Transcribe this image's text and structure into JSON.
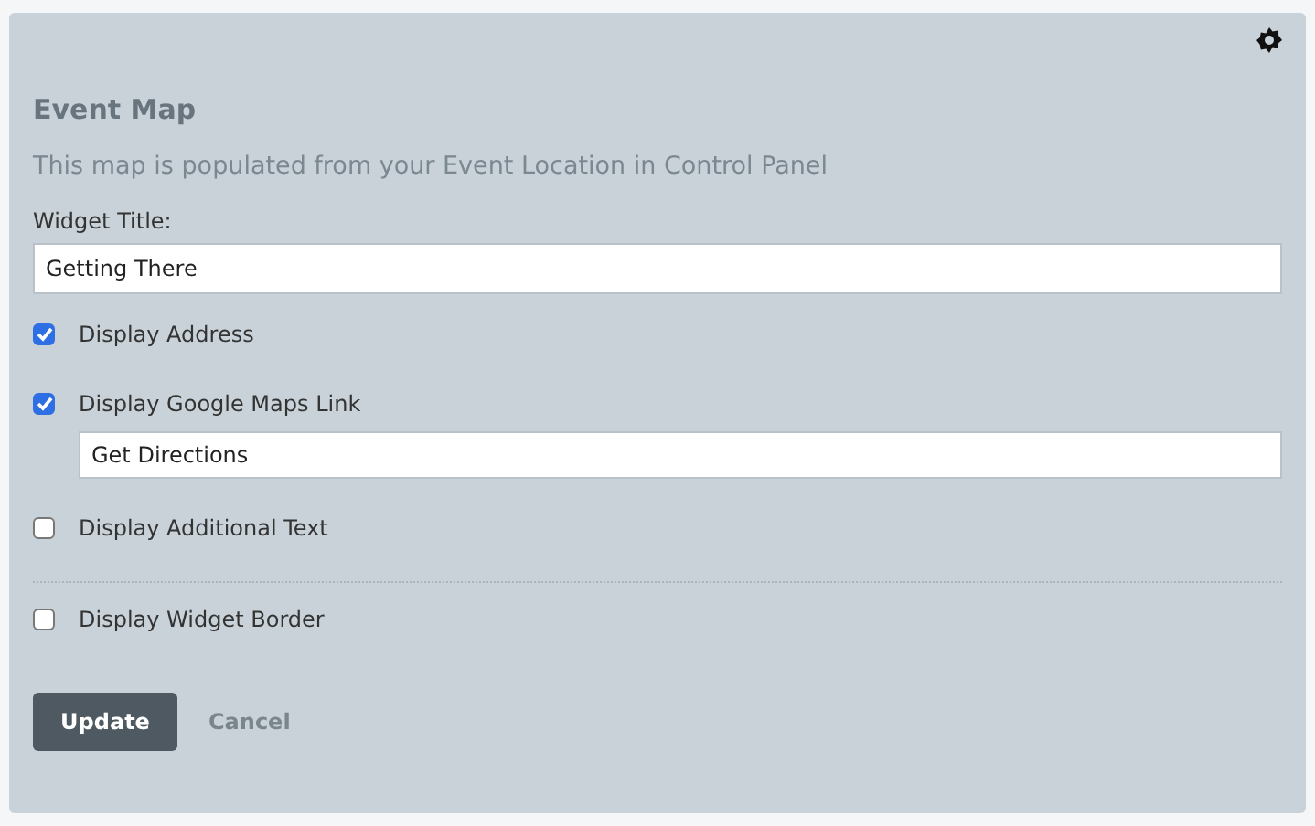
{
  "panel": {
    "title": "Event Map",
    "description": "This map is populated from your Event Location in Control Panel",
    "title_field": {
      "label": "Widget Title:",
      "value": "Getting There"
    },
    "options": [
      {
        "label": "Display Address",
        "checked": true
      },
      {
        "label": "Display Google Maps Link",
        "checked": true,
        "field_value": "Get Directions"
      },
      {
        "label": "Display Additional Text",
        "checked": false
      }
    ],
    "border_options": [
      {
        "label": "Display Widget Border",
        "checked": false
      }
    ],
    "buttons": [
      {
        "label": "Update",
        "kind": "primary"
      },
      {
        "label": "Cancel",
        "kind": "link"
      }
    ]
  }
}
